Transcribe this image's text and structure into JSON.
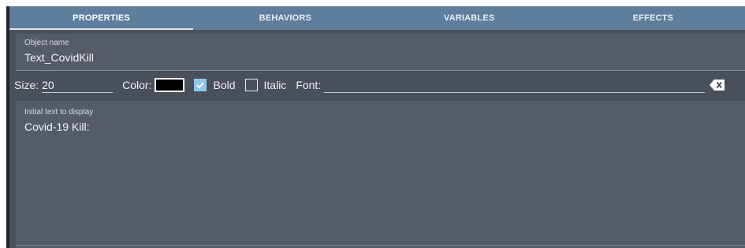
{
  "tabs": [
    {
      "label": "PROPERTIES",
      "active": true
    },
    {
      "label": "BEHAVIORS",
      "active": false
    },
    {
      "label": "VARIABLES",
      "active": false
    },
    {
      "label": "EFFECTS",
      "active": false
    }
  ],
  "object_name": {
    "label": "Object name",
    "value": "Text_CovidKill"
  },
  "toolbar": {
    "size_label": "Size:",
    "size_value": "20",
    "color_label": "Color:",
    "color_value": "#000000",
    "bold_label": "Bold",
    "bold_checked": true,
    "italic_label": "Italic",
    "italic_checked": false,
    "font_label": "Font:",
    "font_value": "",
    "clear_icon": "clear-x-icon"
  },
  "initial_text": {
    "label": "Initial text to display",
    "value": "Covid-19 Kill:"
  },
  "colors": {
    "panel_bg": "#4a4f5c",
    "tab_bar": "#5d7e9c",
    "field_bg": "#565b69",
    "checkbox_checked": "#8fc8ec"
  }
}
